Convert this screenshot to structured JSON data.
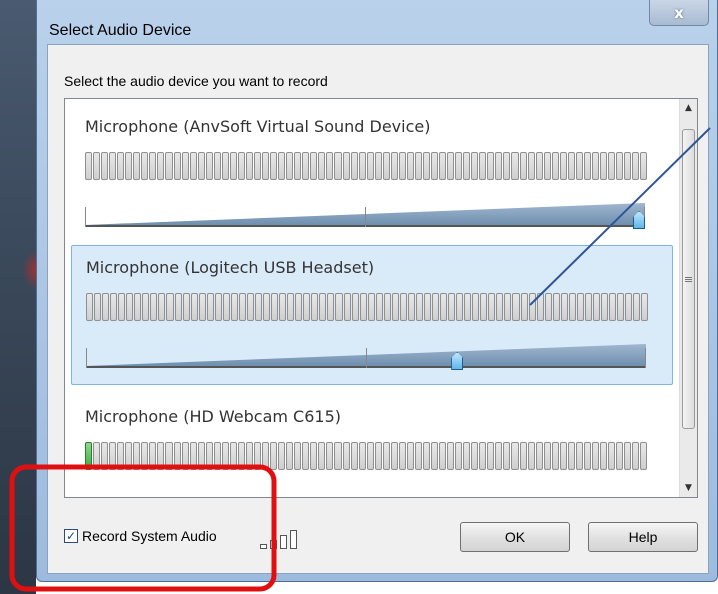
{
  "window": {
    "title": "Select Audio Device",
    "close_glyph": "x"
  },
  "instruction": "Select the audio device you want to record",
  "devices": [
    {
      "name": "Microphone (AnvSoft Virtual Sound Device)",
      "selected": false,
      "volume_level": 1.0,
      "meter_level": 0
    },
    {
      "name": "Microphone (Logitech USB Headset)",
      "selected": true,
      "volume_level": 0.67,
      "meter_level": 0
    },
    {
      "name": "Microphone (HD Webcam C615)",
      "selected": false,
      "volume_level": null,
      "meter_level": 0.02
    }
  ],
  "record_system_audio": {
    "label": "Record System Audio",
    "checked": true,
    "check_glyph": "✓"
  },
  "buttons": {
    "ok": "OK",
    "help": "Help"
  },
  "scrollbar": {
    "up_glyph": "▲",
    "down_glyph": "▼"
  },
  "colors": {
    "selection_bg": "#d9ebf8",
    "meter_active": "#3ca83c",
    "annotation_box": "#e01010",
    "annotation_line": "#2f5597"
  }
}
